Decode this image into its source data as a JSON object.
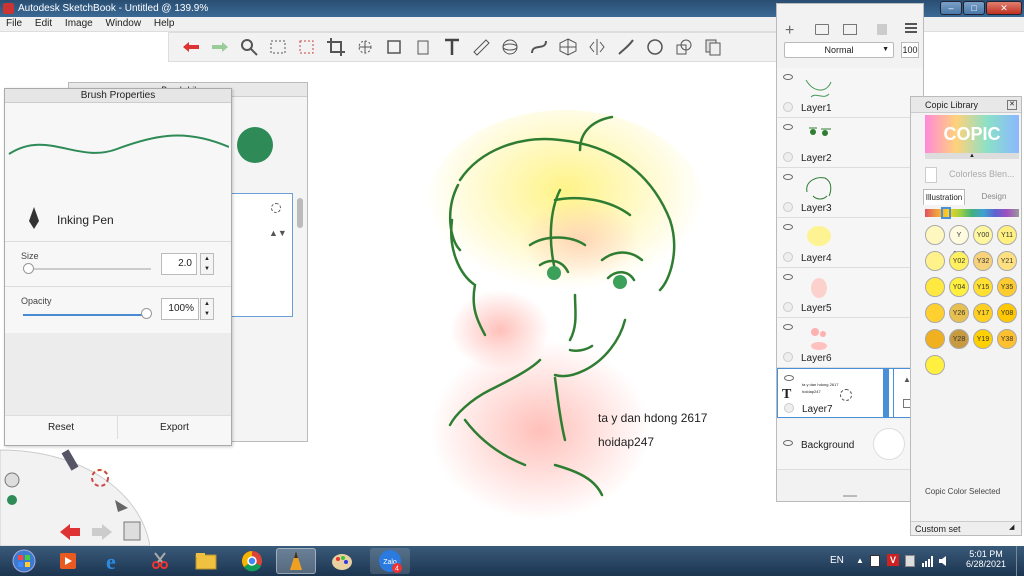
{
  "window": {
    "title": "Autodesk SketchBook - Untitled @ 139.9%"
  },
  "menu": [
    "File",
    "Edit",
    "Image",
    "Window",
    "Help"
  ],
  "toolbar": {
    "icons": [
      "undo-icon",
      "redo-icon",
      "zoom-icon",
      "select-rect-icon",
      "select-lasso-icon",
      "crop-icon",
      "move-icon",
      "distort-icon",
      "fill-icon",
      "text-icon",
      "ruler-icon",
      "ellipse-guide-icon",
      "french-curve-icon",
      "perspective-icon",
      "symmetry-icon",
      "stroke-icon",
      "circle-icon",
      "shape-icon",
      "copy-icon",
      "more-icon"
    ]
  },
  "brush_library": {
    "title": "Brush Library"
  },
  "brush_properties": {
    "title": "Brush Properties",
    "brush_name": "Inking Pen",
    "size_label": "Size",
    "size_value": "2.0",
    "opacity_label": "Opacity",
    "opacity_value": "100%",
    "reset_label": "Reset",
    "export_label": "Export",
    "brush_color": "#2e8b57"
  },
  "canvas": {
    "text_line1": "ta y dan hdong 2617",
    "text_line2": "hoidap247"
  },
  "layers_panel": {
    "blend_mode": "Normal",
    "opacity_value": "100",
    "layers": [
      {
        "name": "Layer1"
      },
      {
        "name": "Layer2"
      },
      {
        "name": "Layer3"
      },
      {
        "name": "Layer4"
      },
      {
        "name": "Layer5"
      },
      {
        "name": "Layer6"
      },
      {
        "name": "Layer7",
        "thumb_text1": "ta y dan hdong 2617",
        "thumb_text2": "hoidap247"
      },
      {
        "name": "Background"
      }
    ]
  },
  "copic": {
    "title": "Copic Library",
    "logo": "COPIC",
    "blender_label": "Colorless Blen...",
    "tab_illustration": "Illustration",
    "tab_design": "Design",
    "swatches": [
      {
        "label": "",
        "color": "#fff7c0"
      },
      {
        "label": "Y 000",
        "color": "#fffbe0"
      },
      {
        "label": "Y00",
        "color": "#fff6a0"
      },
      {
        "label": "Y11",
        "color": "#fff080"
      },
      {
        "label": "",
        "color": "#fff28a"
      },
      {
        "label": "Y02",
        "color": "#fff060"
      },
      {
        "label": "Y32",
        "color": "#f7d27a"
      },
      {
        "label": "Y21",
        "color": "#ffe080"
      },
      {
        "label": "",
        "color": "#ffe840"
      },
      {
        "label": "Y04",
        "color": "#fff040"
      },
      {
        "label": "Y15",
        "color": "#ffe030"
      },
      {
        "label": "Y35",
        "color": "#ffcc30"
      },
      {
        "label": "",
        "color": "#ffd030"
      },
      {
        "label": "Y26",
        "color": "#e8c050"
      },
      {
        "label": "Y17",
        "color": "#ffd020"
      },
      {
        "label": "Y08",
        "color": "#ffc800"
      },
      {
        "label": "",
        "color": "#f0b020"
      },
      {
        "label": "Y28",
        "color": "#c89a40"
      },
      {
        "label": "Y19",
        "color": "#ffd000"
      },
      {
        "label": "Y38",
        "color": "#ffc030"
      },
      {
        "label": "",
        "color": "#fff040"
      }
    ],
    "selected_label": "Copic Color Selected",
    "custom_set_label": "Custom set"
  },
  "taskbar": {
    "lang": "EN",
    "time": "5:01 PM",
    "date": "6/28/2021",
    "zalo_label": "Zalo",
    "zalo_badge": "4"
  }
}
